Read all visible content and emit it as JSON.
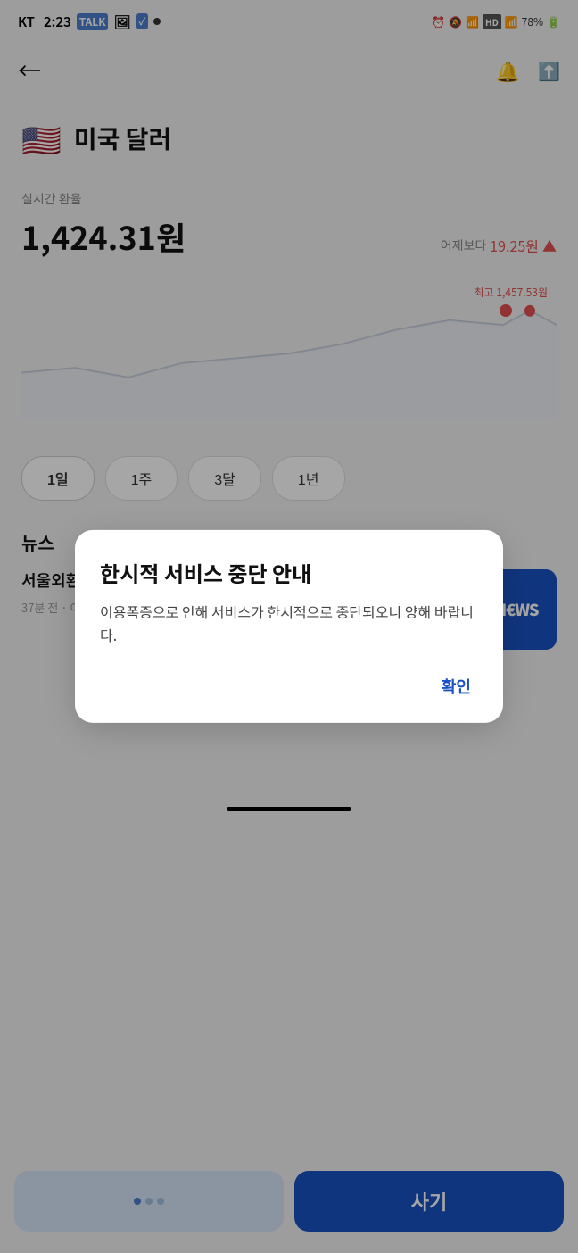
{
  "statusBar": {
    "carrier": "KT",
    "time": "2:23",
    "battery": "78%",
    "signal": "4"
  },
  "nav": {
    "backLabel": "←",
    "bellIcon": "🔔",
    "shareIcon": "⬆"
  },
  "currency": {
    "flag": "🇺🇸",
    "name": "미국 달러"
  },
  "rate": {
    "label": "실시간 환율",
    "value": "1,424.31원",
    "changeLabel": "어제보다",
    "changeValue": "19.25원",
    "changeArrow": "▲",
    "maxLabel": "최고 1,457.53원"
  },
  "periods": [
    {
      "label": "1일",
      "active": true
    },
    {
      "label": "1주",
      "active": false
    },
    {
      "label": "3달",
      "active": false
    },
    {
      "label": "1년",
      "active": false
    }
  ],
  "news": {
    "sectionTitle": "뉴스",
    "items": [
      {
        "headline": "서울외환시장 오늘 평소대로 개장할 듯",
        "timeAgo": "37분 전",
        "source": "이슈",
        "thumbnailText": "N€WS"
      }
    ]
  },
  "bottomBar": {
    "buyLabel": "사기"
  },
  "modal": {
    "title": "한시적 서비스 중단 안내",
    "body": "이용폭증으로 인해 서비스가 한시적으로 중단되오니 양해 바랍니다.",
    "confirmLabel": "확인"
  }
}
